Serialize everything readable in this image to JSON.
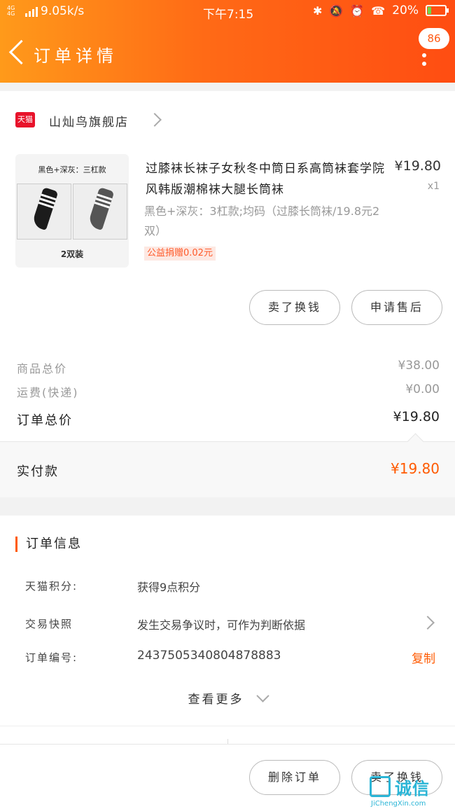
{
  "status_bar": {
    "signal_label": "4G 4G",
    "speed": "9.05k/s",
    "time": "下午7:15",
    "icons": [
      "bluetooth-icon",
      "mute-bell-icon",
      "alarm-icon",
      "hd-call-icon"
    ],
    "battery": "20%",
    "battery_level": 0.2
  },
  "header": {
    "title": "订单详情",
    "message_count": "86"
  },
  "shop": {
    "badge": "天猫",
    "name": "山灿鸟旗舰店"
  },
  "product": {
    "image_caption": "黑色+深灰：三杠款",
    "image_count": "2双装",
    "title": "过膝袜长袜子女秋冬中筒日系高筒袜套学院风韩版潮棉袜大腿长筒袜",
    "price": "¥19.80",
    "qty": "x1",
    "spec": "黑色+深灰：3杠款;均码（过膝长筒袜/19.8元2双）",
    "promo": "公益捐赠0.02元",
    "actions": [
      "卖了换钱",
      "申请售后"
    ]
  },
  "summary": {
    "goods_total_label": "商品总价",
    "goods_total": "¥38.00",
    "shipping_label": "运费(快递)",
    "shipping": "¥0.00",
    "order_total_label": "订单总价",
    "order_total": "¥19.80",
    "paid_label": "实付款",
    "paid": "¥19.80"
  },
  "order_info": {
    "section_title": "订单信息",
    "rows": [
      {
        "label": "天猫积分:",
        "value": "获得9点积分"
      },
      {
        "label": "交易快照",
        "value": "发生交易争议时，可作为判断依据"
      },
      {
        "label": "订单编号:",
        "value": "2437505340804878883"
      }
    ],
    "copy_label": "复制",
    "view_more": "查看更多"
  },
  "bottom_actions": [
    "删除订单",
    "卖了换钱"
  ],
  "watermark": {
    "text": "诚信",
    "url": "JiChengXin.com"
  },
  "colors": {
    "header_start": "#ff9a1a",
    "header_end": "#ff4d12",
    "accent": "#ff5a00"
  }
}
